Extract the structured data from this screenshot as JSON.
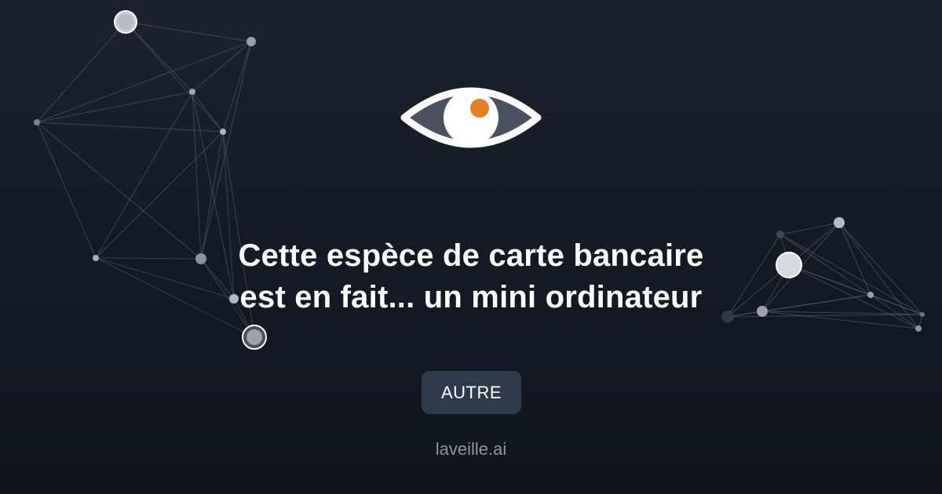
{
  "logo": {
    "icon": "eye-icon",
    "colors": {
      "outline": "#ffffff",
      "iris": "#ffffff",
      "pupil": "#e67e22",
      "fill": "#4a5260"
    }
  },
  "headline": {
    "text": "Cette espèce de carte bancaire est en fait... un mini ordinateur"
  },
  "category": {
    "label": "AUTRE"
  },
  "site": {
    "name": "laveille.ai"
  },
  "colors": {
    "background_top": "#1b222d",
    "background_bottom": "#0f141c",
    "button_background": "#2f3b4c",
    "site_text": "#8b95a5"
  }
}
